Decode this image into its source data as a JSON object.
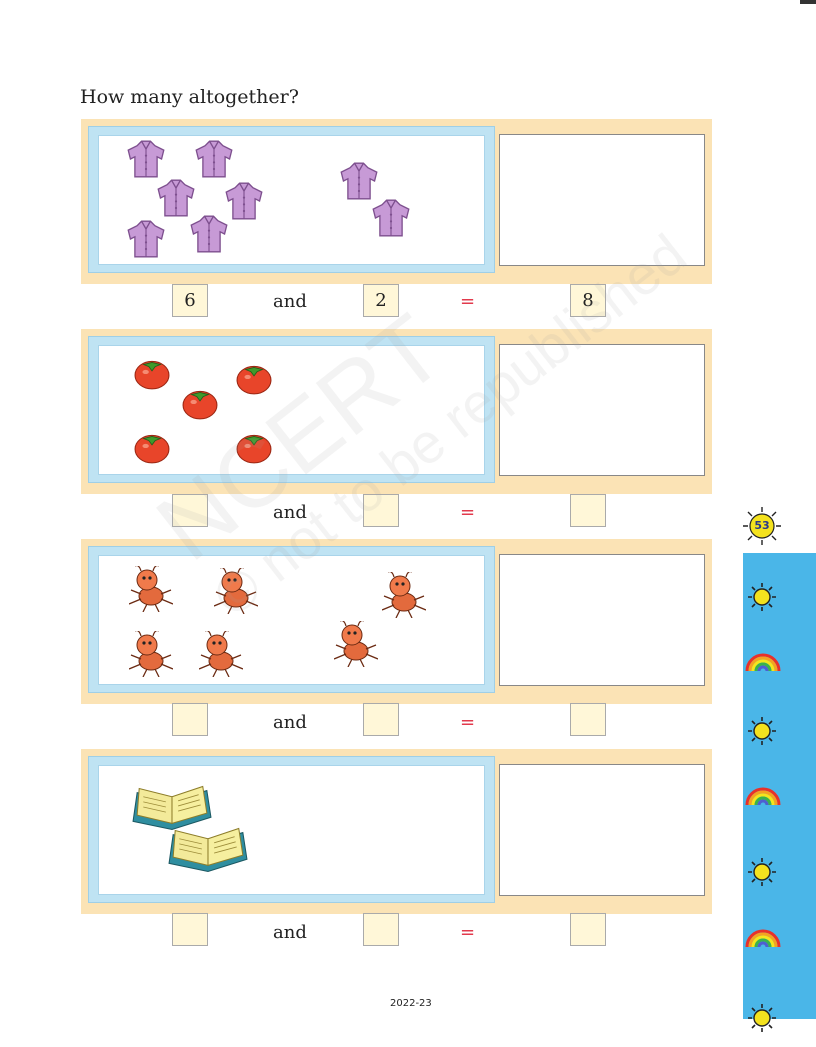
{
  "heading": "How many altogether?",
  "word_and": "and",
  "equals": "=",
  "rows": [
    {
      "picture": "shirts",
      "first": "6",
      "second": "2",
      "total": "8"
    },
    {
      "picture": "tomatoes",
      "first": "",
      "second": "",
      "total": ""
    },
    {
      "picture": "ants",
      "first": "",
      "second": "",
      "total": ""
    },
    {
      "picture": "books",
      "first": "",
      "second": "",
      "total": ""
    }
  ],
  "page_number": "53",
  "footer": "2022-23",
  "watermark": {
    "line1": "NCERT",
    "line2": "© not to be republished"
  },
  "colors": {
    "panel": "#fbe3b5",
    "frame": "#bfe3f3",
    "strip": "#4ab6e8",
    "equals": "#e23a4c"
  },
  "icons": [
    "shirt-icon",
    "tomato-icon",
    "ant-icon",
    "book-icon",
    "sun-icon",
    "rainbow-icon"
  ]
}
